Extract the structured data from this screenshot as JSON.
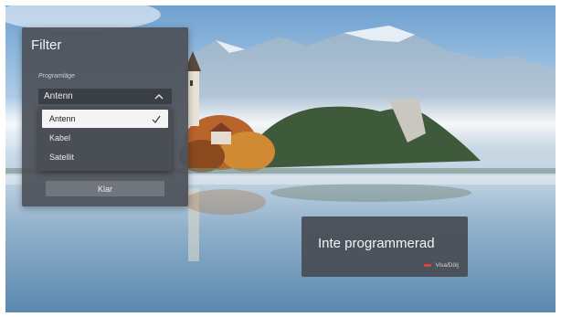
{
  "filter_panel": {
    "title": "Filter",
    "mode_label": "Programläge",
    "selected_value": "Antenn",
    "options": [
      {
        "label": "Antenn",
        "selected": true
      },
      {
        "label": "Kabel",
        "selected": false
      },
      {
        "label": "Satellit",
        "selected": false
      }
    ],
    "done_label": "Klar"
  },
  "status_card": {
    "title": "Inte programmerad",
    "hint_label": "Visa/Dölj",
    "hint_key_color": "#e0423a"
  },
  "colors": {
    "panel_bg": "#4e525a",
    "selected_option_bg": "#f4f4f4"
  }
}
